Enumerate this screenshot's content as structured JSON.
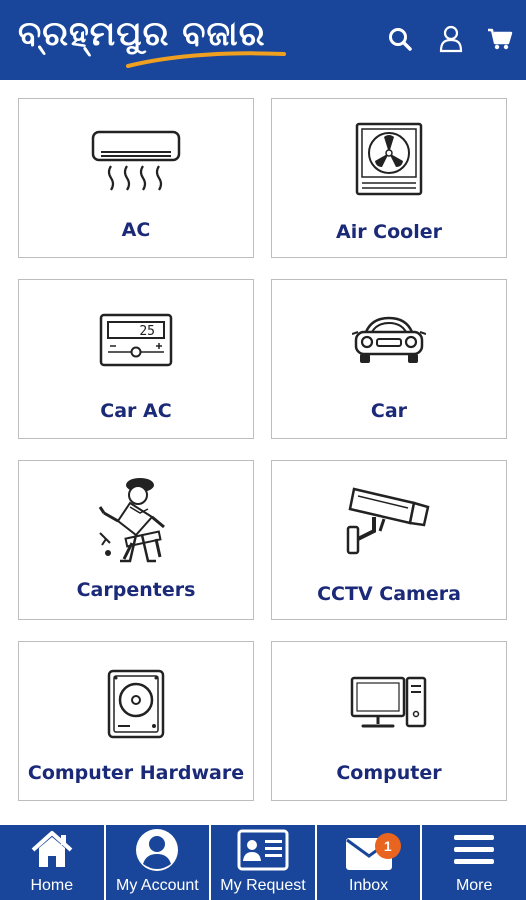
{
  "header": {
    "logo_text": "ବ୍ରହ୍ମପୁର ବଜାର",
    "icons": [
      "search-icon",
      "user-icon",
      "cart-icon"
    ]
  },
  "categories": [
    {
      "label": "AC",
      "icon": "ac-icon"
    },
    {
      "label": "Air Cooler",
      "icon": "air-cooler-icon"
    },
    {
      "label": "Car AC",
      "icon": "car-ac-icon"
    },
    {
      "label": "Car",
      "icon": "car-icon"
    },
    {
      "label": "Carpenters",
      "icon": "carpenter-icon"
    },
    {
      "label": "CCTV Camera",
      "icon": "cctv-camera-icon"
    },
    {
      "label": "Computer Hardware",
      "icon": "hard-disk-icon"
    },
    {
      "label": "Computer",
      "icon": "computer-icon"
    }
  ],
  "car_ac_display": "25",
  "bottom_nav": [
    {
      "label": "Home",
      "icon": "home-icon"
    },
    {
      "label": "My Account",
      "icon": "account-icon"
    },
    {
      "label": "My Request",
      "icon": "request-card-icon"
    },
    {
      "label": "Inbox",
      "icon": "mail-icon",
      "badge": "1"
    },
    {
      "label": "More",
      "icon": "menu-icon"
    }
  ],
  "colors": {
    "primary": "#19469a",
    "label": "#1b2a78",
    "badge": "#e8641f"
  }
}
